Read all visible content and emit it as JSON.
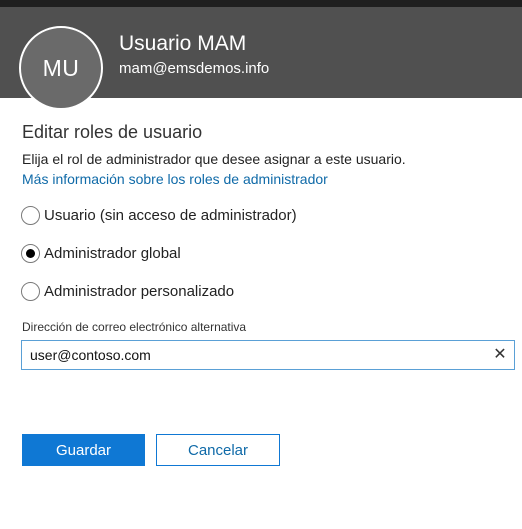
{
  "user": {
    "initials": "MU",
    "name": "Usuario MAM",
    "email": "mam@emsdemos.info"
  },
  "form": {
    "title": "Editar roles de usuario",
    "description": "Elija el rol de administrador que desee asignar a este usuario.",
    "learn_more_link": "Más información sobre los roles de administrador",
    "roles": [
      {
        "label": "Usuario (sin acceso de administrador)",
        "selected": false
      },
      {
        "label": "Administrador global",
        "selected": true
      },
      {
        "label": "Administrador personalizado",
        "selected": false
      }
    ],
    "alt_email_label": "Dirección de correo electrónico alternativa",
    "alt_email_value": "user@contoso.com",
    "clear_icon": "close-icon"
  },
  "buttons": {
    "save_label": "Guardar",
    "cancel_label": "Cancelar"
  },
  "colors": {
    "header_bg": "#505050",
    "accent": "#0f78d4",
    "link": "#0f6aa8"
  }
}
